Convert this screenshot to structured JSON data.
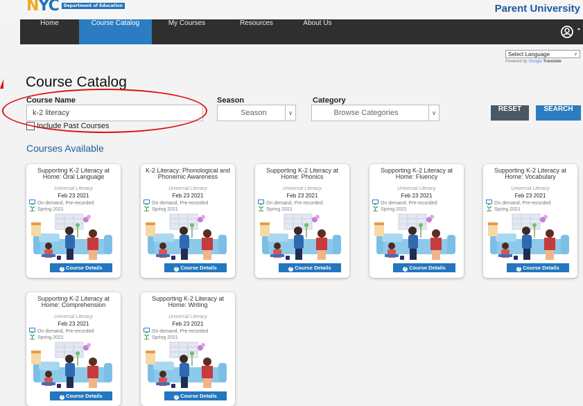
{
  "header": {
    "logo_text": "NYC",
    "logo_dept": "Department of Education",
    "brand": "Parent University"
  },
  "nav": {
    "items": [
      "Home",
      "Course Catalog",
      "My Courses",
      "Resources",
      "About Us"
    ],
    "active": "Course Catalog",
    "user_icon": "user-circle-icon"
  },
  "translate": {
    "label": "Select Language",
    "powered_prefix": "Powered by",
    "powered_google": "Google",
    "powered_suffix": "Translate"
  },
  "page_title": "Course Catalog",
  "filters": {
    "course_name_label": "Course Name",
    "course_name_value": "k-2 literacy",
    "season_label": "Season",
    "season_value": "Season",
    "category_label": "Category",
    "category_value": "Browse Categories",
    "include_past_label": "Include Past Courses",
    "reset_label": "RESET",
    "search_label": "SEARCH"
  },
  "colors": {
    "nav_bg": "#2f2f2f",
    "accent": "#2b7cc1",
    "reset_bg": "#4a5864",
    "annotation": "#dd1111"
  },
  "section_title": "Courses Available",
  "cards": [
    {
      "title": "Supporting K-2 Literacy at Home: Oral Language",
      "category": "Universal Literacy",
      "date": "Feb 23 2021",
      "mode": "On demand, Pre-recorded",
      "season": "Spring 2021",
      "button": "Course Details"
    },
    {
      "title": "K-2 Literacy: Phonological and Phonemic Awareness",
      "category": "Universal Literacy",
      "date": "Feb 23 2021",
      "mode": "On demand, Pre-recorded",
      "season": "Spring 2021",
      "button": "Course Details"
    },
    {
      "title": "Supporting K-2 Literacy at Home: Phonics",
      "category": "Universal Literacy",
      "date": "Feb 23 2021",
      "mode": "On demand, Pre-recorded",
      "season": "Spring 2021",
      "button": "Course Details"
    },
    {
      "title": "Supporting K-2 Literacy at Home: Fluency",
      "category": "Universal Literacy",
      "date": "Feb 23 2021",
      "mode": "On demand, Pre-recorded",
      "season": "Spring 2021",
      "button": "Course Details"
    },
    {
      "title": "Supporting K-2 Literacy at Home: Vocabulary",
      "category": "Universal Literacy",
      "date": "Feb 23 2021",
      "mode": "On demand, Pre-recorded",
      "season": "Spring 2021",
      "button": "Course Details"
    },
    {
      "title": "Supporting K-2 Literacy at Home: Comprehension",
      "category": "Universal Literacy",
      "date": "Feb 23 2021",
      "mode": "On demand, Pre-recorded",
      "season": "Spring 2021",
      "button": "Course Details"
    },
    {
      "title": "Supporting K-2 Literacy at Home: Writing",
      "category": "Universal Literacy",
      "date": "Feb 23 2021",
      "mode": "On demand, Pre-recorded",
      "season": "Spring 2021",
      "button": "Course Details"
    }
  ]
}
